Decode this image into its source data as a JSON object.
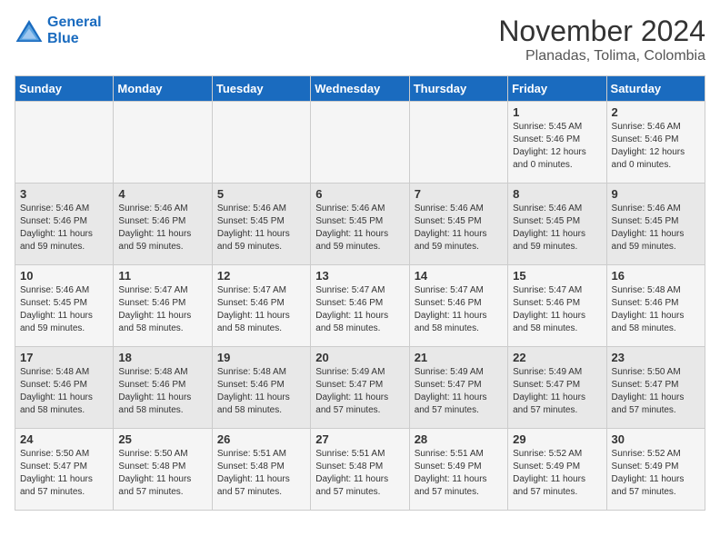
{
  "logo": {
    "line1": "General",
    "line2": "Blue"
  },
  "title": "November 2024",
  "subtitle": "Planadas, Tolima, Colombia",
  "days_of_week": [
    "Sunday",
    "Monday",
    "Tuesday",
    "Wednesday",
    "Thursday",
    "Friday",
    "Saturday"
  ],
  "weeks": [
    [
      {
        "day": "",
        "info": ""
      },
      {
        "day": "",
        "info": ""
      },
      {
        "day": "",
        "info": ""
      },
      {
        "day": "",
        "info": ""
      },
      {
        "day": "",
        "info": ""
      },
      {
        "day": "1",
        "info": "Sunrise: 5:45 AM\nSunset: 5:46 PM\nDaylight: 12 hours\nand 0 minutes."
      },
      {
        "day": "2",
        "info": "Sunrise: 5:46 AM\nSunset: 5:46 PM\nDaylight: 12 hours\nand 0 minutes."
      }
    ],
    [
      {
        "day": "3",
        "info": "Sunrise: 5:46 AM\nSunset: 5:46 PM\nDaylight: 11 hours\nand 59 minutes."
      },
      {
        "day": "4",
        "info": "Sunrise: 5:46 AM\nSunset: 5:46 PM\nDaylight: 11 hours\nand 59 minutes."
      },
      {
        "day": "5",
        "info": "Sunrise: 5:46 AM\nSunset: 5:45 PM\nDaylight: 11 hours\nand 59 minutes."
      },
      {
        "day": "6",
        "info": "Sunrise: 5:46 AM\nSunset: 5:45 PM\nDaylight: 11 hours\nand 59 minutes."
      },
      {
        "day": "7",
        "info": "Sunrise: 5:46 AM\nSunset: 5:45 PM\nDaylight: 11 hours\nand 59 minutes."
      },
      {
        "day": "8",
        "info": "Sunrise: 5:46 AM\nSunset: 5:45 PM\nDaylight: 11 hours\nand 59 minutes."
      },
      {
        "day": "9",
        "info": "Sunrise: 5:46 AM\nSunset: 5:45 PM\nDaylight: 11 hours\nand 59 minutes."
      }
    ],
    [
      {
        "day": "10",
        "info": "Sunrise: 5:46 AM\nSunset: 5:45 PM\nDaylight: 11 hours\nand 59 minutes."
      },
      {
        "day": "11",
        "info": "Sunrise: 5:47 AM\nSunset: 5:46 PM\nDaylight: 11 hours\nand 58 minutes."
      },
      {
        "day": "12",
        "info": "Sunrise: 5:47 AM\nSunset: 5:46 PM\nDaylight: 11 hours\nand 58 minutes."
      },
      {
        "day": "13",
        "info": "Sunrise: 5:47 AM\nSunset: 5:46 PM\nDaylight: 11 hours\nand 58 minutes."
      },
      {
        "day": "14",
        "info": "Sunrise: 5:47 AM\nSunset: 5:46 PM\nDaylight: 11 hours\nand 58 minutes."
      },
      {
        "day": "15",
        "info": "Sunrise: 5:47 AM\nSunset: 5:46 PM\nDaylight: 11 hours\nand 58 minutes."
      },
      {
        "day": "16",
        "info": "Sunrise: 5:48 AM\nSunset: 5:46 PM\nDaylight: 11 hours\nand 58 minutes."
      }
    ],
    [
      {
        "day": "17",
        "info": "Sunrise: 5:48 AM\nSunset: 5:46 PM\nDaylight: 11 hours\nand 58 minutes."
      },
      {
        "day": "18",
        "info": "Sunrise: 5:48 AM\nSunset: 5:46 PM\nDaylight: 11 hours\nand 58 minutes."
      },
      {
        "day": "19",
        "info": "Sunrise: 5:48 AM\nSunset: 5:46 PM\nDaylight: 11 hours\nand 58 minutes."
      },
      {
        "day": "20",
        "info": "Sunrise: 5:49 AM\nSunset: 5:47 PM\nDaylight: 11 hours\nand 57 minutes."
      },
      {
        "day": "21",
        "info": "Sunrise: 5:49 AM\nSunset: 5:47 PM\nDaylight: 11 hours\nand 57 minutes."
      },
      {
        "day": "22",
        "info": "Sunrise: 5:49 AM\nSunset: 5:47 PM\nDaylight: 11 hours\nand 57 minutes."
      },
      {
        "day": "23",
        "info": "Sunrise: 5:50 AM\nSunset: 5:47 PM\nDaylight: 11 hours\nand 57 minutes."
      }
    ],
    [
      {
        "day": "24",
        "info": "Sunrise: 5:50 AM\nSunset: 5:47 PM\nDaylight: 11 hours\nand 57 minutes."
      },
      {
        "day": "25",
        "info": "Sunrise: 5:50 AM\nSunset: 5:48 PM\nDaylight: 11 hours\nand 57 minutes."
      },
      {
        "day": "26",
        "info": "Sunrise: 5:51 AM\nSunset: 5:48 PM\nDaylight: 11 hours\nand 57 minutes."
      },
      {
        "day": "27",
        "info": "Sunrise: 5:51 AM\nSunset: 5:48 PM\nDaylight: 11 hours\nand 57 minutes."
      },
      {
        "day": "28",
        "info": "Sunrise: 5:51 AM\nSunset: 5:49 PM\nDaylight: 11 hours\nand 57 minutes."
      },
      {
        "day": "29",
        "info": "Sunrise: 5:52 AM\nSunset: 5:49 PM\nDaylight: 11 hours\nand 57 minutes."
      },
      {
        "day": "30",
        "info": "Sunrise: 5:52 AM\nSunset: 5:49 PM\nDaylight: 11 hours\nand 57 minutes."
      }
    ]
  ]
}
